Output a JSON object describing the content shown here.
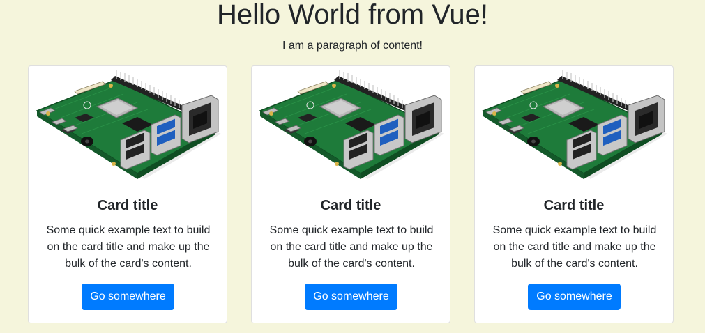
{
  "header": {
    "title": "Hello World from Vue!",
    "paragraph": "I am a paragraph of content!"
  },
  "cards": [
    {
      "image": "raspberry-pi-board-image",
      "title": "Card title",
      "text": "Some quick example text to build on the card title and make up the bulk of the card's content.",
      "button_label": "Go somewhere"
    },
    {
      "image": "raspberry-pi-board-image",
      "title": "Card title",
      "text": "Some quick example text to build on the card title and make up the bulk of the card's content.",
      "button_label": "Go somewhere"
    },
    {
      "image": "raspberry-pi-board-image",
      "title": "Card title",
      "text": "Some quick example text to build on the card title and make up the bulk of the card's content.",
      "button_label": "Go somewhere"
    }
  ],
  "colors": {
    "background": "#f5f5dc",
    "button": "#007bff",
    "board_green": "#1e7b3a"
  }
}
